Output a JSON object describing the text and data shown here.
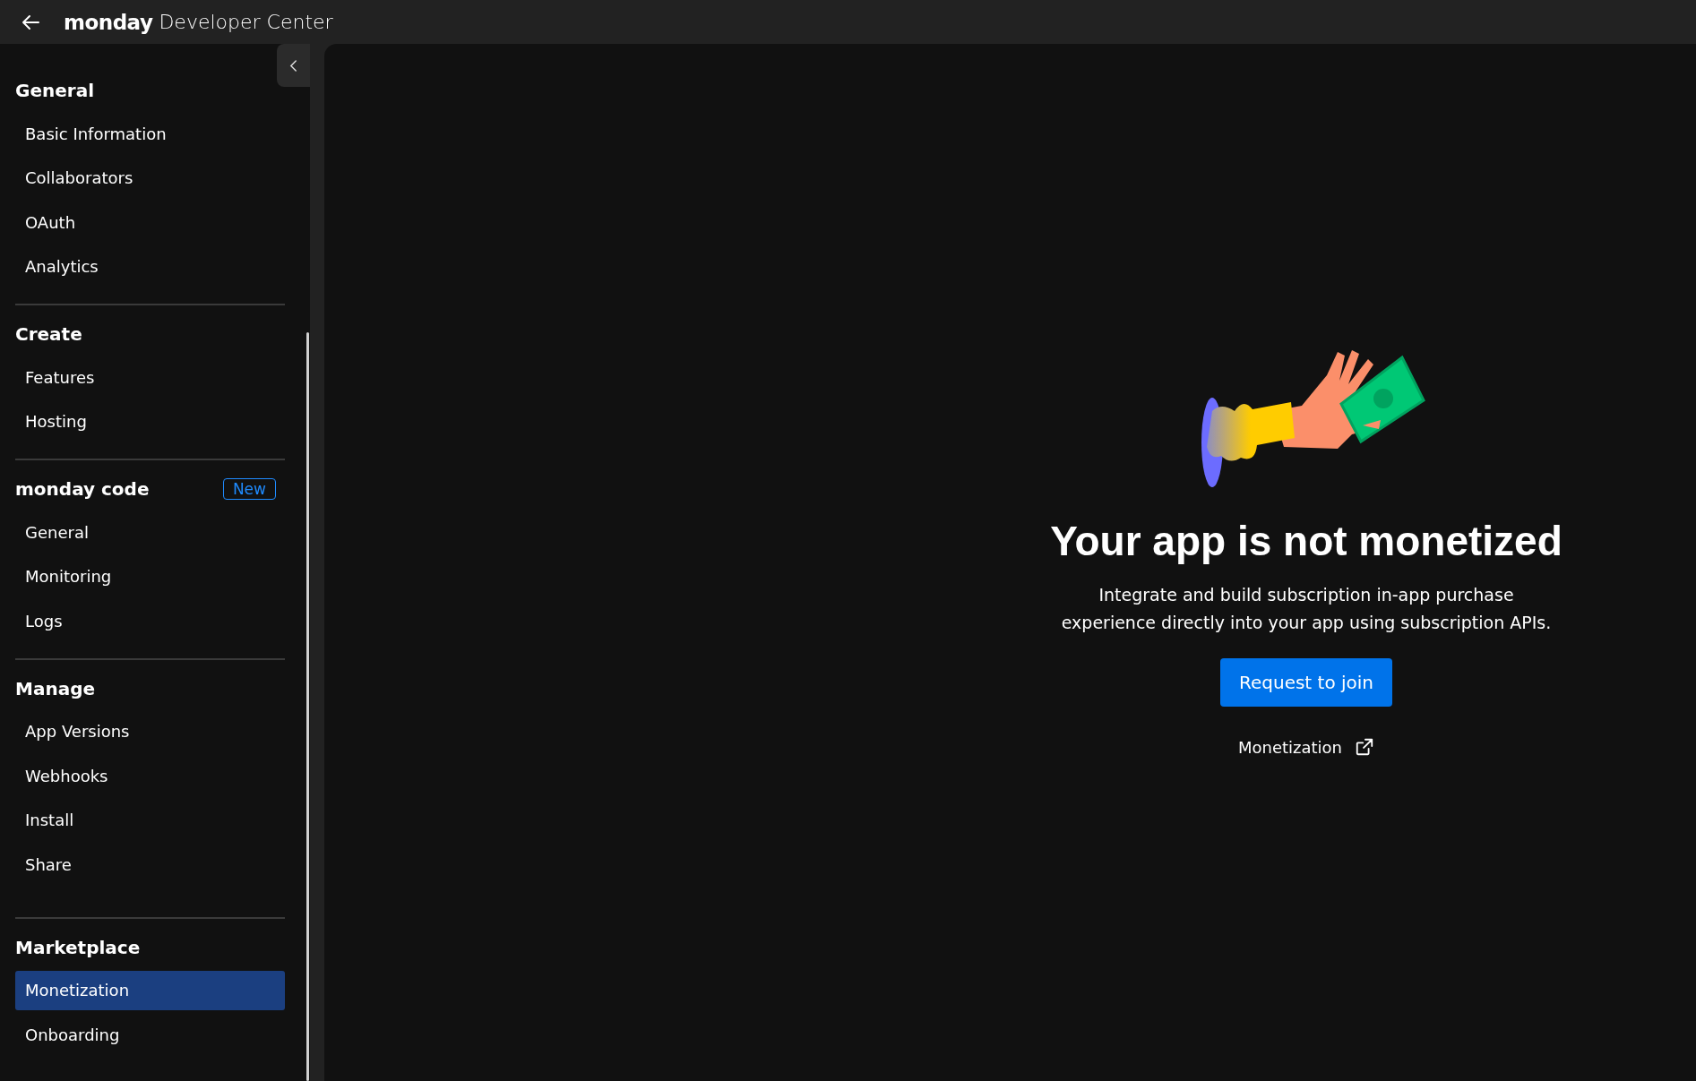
{
  "header": {
    "brand": "monday",
    "product": "Developer Center"
  },
  "sidebar": {
    "sections": [
      {
        "heading": "General",
        "items": [
          {
            "label": "Basic Information",
            "selected": false
          },
          {
            "label": "Collaborators",
            "selected": false
          },
          {
            "label": "OAuth",
            "selected": false
          },
          {
            "label": "Analytics",
            "selected": false
          }
        ]
      },
      {
        "heading": "Create",
        "items": [
          {
            "label": "Features",
            "selected": false
          },
          {
            "label": "Hosting",
            "selected": false
          }
        ]
      },
      {
        "heading": "monday code",
        "badge": "New",
        "items": [
          {
            "label": "General",
            "selected": false
          },
          {
            "label": "Monitoring",
            "selected": false
          },
          {
            "label": "Logs",
            "selected": false
          }
        ]
      },
      {
        "heading": "Manage",
        "items": [
          {
            "label": "App Versions",
            "selected": false
          },
          {
            "label": "Webhooks",
            "selected": false
          },
          {
            "label": "Install",
            "selected": false
          },
          {
            "label": "Share",
            "selected": false
          }
        ]
      },
      {
        "heading": "Marketplace",
        "items": [
          {
            "label": "Monetization",
            "selected": true
          },
          {
            "label": "Onboarding",
            "selected": false
          }
        ]
      }
    ]
  },
  "empty_state": {
    "title": "Your app is not monetized",
    "description": "Integrate and build subscription in-app purchase experience directly into your app using subscription APIs.",
    "button": "Request to join",
    "link": "Monetization"
  }
}
